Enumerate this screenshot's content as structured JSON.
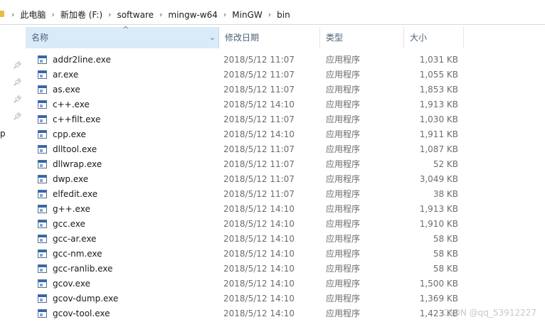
{
  "breadcrumb": [
    "此电脑",
    "新加卷 (F:)",
    "software",
    "mingw-w64",
    "MinGW",
    "bin"
  ],
  "columns": {
    "name": "名称",
    "date": "修改日期",
    "type": "类型",
    "size": "大小"
  },
  "nav_fragment": "p",
  "files": [
    {
      "name": "addr2line.exe",
      "date": "2018/5/12 11:07",
      "type": "应用程序",
      "size": "1,031 KB"
    },
    {
      "name": "ar.exe",
      "date": "2018/5/12 11:07",
      "type": "应用程序",
      "size": "1,055 KB"
    },
    {
      "name": "as.exe",
      "date": "2018/5/12 11:07",
      "type": "应用程序",
      "size": "1,853 KB"
    },
    {
      "name": "c++.exe",
      "date": "2018/5/12 14:10",
      "type": "应用程序",
      "size": "1,913 KB"
    },
    {
      "name": "c++filt.exe",
      "date": "2018/5/12 11:07",
      "type": "应用程序",
      "size": "1,030 KB"
    },
    {
      "name": "cpp.exe",
      "date": "2018/5/12 14:10",
      "type": "应用程序",
      "size": "1,911 KB"
    },
    {
      "name": "dlltool.exe",
      "date": "2018/5/12 11:07",
      "type": "应用程序",
      "size": "1,087 KB"
    },
    {
      "name": "dllwrap.exe",
      "date": "2018/5/12 11:07",
      "type": "应用程序",
      "size": "52 KB"
    },
    {
      "name": "dwp.exe",
      "date": "2018/5/12 11:07",
      "type": "应用程序",
      "size": "3,049 KB"
    },
    {
      "name": "elfedit.exe",
      "date": "2018/5/12 11:07",
      "type": "应用程序",
      "size": "38 KB"
    },
    {
      "name": "g++.exe",
      "date": "2018/5/12 14:10",
      "type": "应用程序",
      "size": "1,913 KB"
    },
    {
      "name": "gcc.exe",
      "date": "2018/5/12 14:10",
      "type": "应用程序",
      "size": "1,910 KB"
    },
    {
      "name": "gcc-ar.exe",
      "date": "2018/5/12 14:10",
      "type": "应用程序",
      "size": "58 KB"
    },
    {
      "name": "gcc-nm.exe",
      "date": "2018/5/12 14:10",
      "type": "应用程序",
      "size": "58 KB"
    },
    {
      "name": "gcc-ranlib.exe",
      "date": "2018/5/12 14:10",
      "type": "应用程序",
      "size": "58 KB"
    },
    {
      "name": "gcov.exe",
      "date": "2018/5/12 14:10",
      "type": "应用程序",
      "size": "1,500 KB"
    },
    {
      "name": "gcov-dump.exe",
      "date": "2018/5/12 14:10",
      "type": "应用程序",
      "size": "1,369 KB"
    },
    {
      "name": "gcov-tool.exe",
      "date": "2018/5/12 14:10",
      "type": "应用程序",
      "size": "1,423 KB"
    }
  ],
  "watermark": "CSDN @qq_53912227"
}
